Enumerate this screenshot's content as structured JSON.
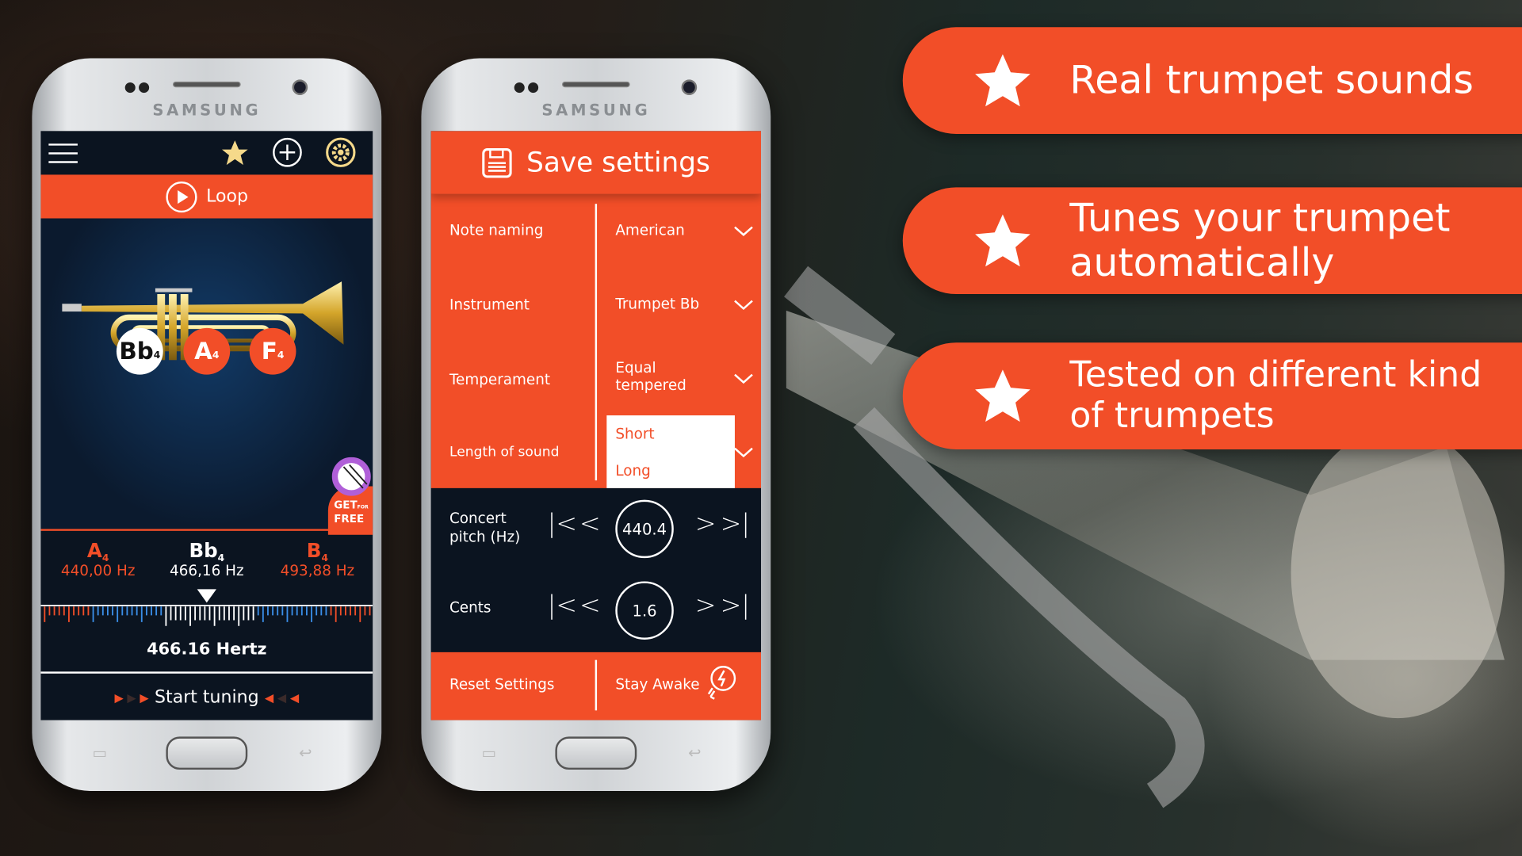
{
  "device_brand": "SAMSUNG",
  "colors": {
    "accent": "#f24e28",
    "dark": "#0b1420",
    "star": "#f5d98a",
    "lilac": "#b05fd8"
  },
  "tuner_screen": {
    "toolbar": {
      "icons": [
        "menu-icon",
        "star-icon",
        "plus-circle-icon",
        "gear-icon"
      ]
    },
    "loop_label": "Loop",
    "notes": [
      {
        "name": "Bb",
        "octave": "4",
        "selected": true
      },
      {
        "name": "A",
        "octave": "4"
      },
      {
        "name": "F",
        "octave": "4"
      }
    ],
    "promo": {
      "line1": "GET",
      "small": "FOR",
      "line2": "FREE"
    },
    "readouts": [
      {
        "name": "A",
        "octave": "4",
        "freq": "440,00 Hz"
      },
      {
        "name": "Bb",
        "octave": "4",
        "freq": "466,16 Hz"
      },
      {
        "name": "B",
        "octave": "4",
        "freq": "493,88 Hz"
      }
    ],
    "hertz": "466.16 Hertz",
    "start_label": "Start tuning"
  },
  "settings_screen": {
    "title": "Save settings",
    "rows": [
      {
        "label": "Note naming",
        "value": "American"
      },
      {
        "label": "Instrument",
        "value": "Trumpet Bb"
      },
      {
        "label": "Temperament",
        "value": "Equal tempered"
      },
      {
        "label": "Length of sound",
        "options": [
          "Short",
          "Long"
        ]
      }
    ],
    "concert_pitch": {
      "label": "Concert pitch (Hz)",
      "value": "440.4"
    },
    "cents": {
      "label": "Cents",
      "value": "1.6"
    },
    "reset_label": "Reset Settings",
    "stay_awake_label": "Stay Awake"
  },
  "banners": [
    "Real trumpet sounds",
    "Tunes your trumpet automatically",
    "Tested on different kind of trumpets"
  ]
}
